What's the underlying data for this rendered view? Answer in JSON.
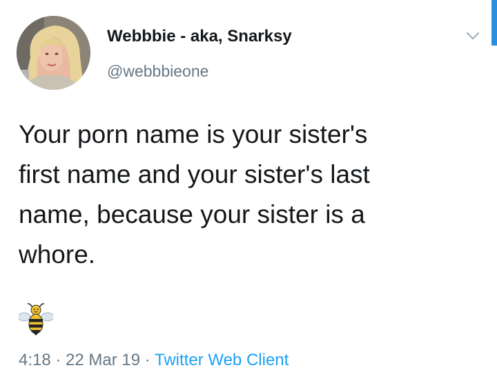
{
  "tweet": {
    "author": {
      "display_name": "Webbbie - aka, Snarksy",
      "handle": "@webbbieone",
      "avatar_icon": "profile-photo"
    },
    "text": "Your porn name is your sister's\nfirst name and your sister's last\nname, because your sister is a\nwhore.",
    "emoji": "bee-icon",
    "time": "4:18",
    "separator": " · ",
    "date": "22 Mar 19",
    "source": "Twitter Web Client",
    "caret_icon": "chevron-down-icon"
  },
  "colors": {
    "text": "#14171a",
    "secondary": "#657786",
    "link": "#1da1f2",
    "scroll_edge": "#2a8fe0"
  }
}
